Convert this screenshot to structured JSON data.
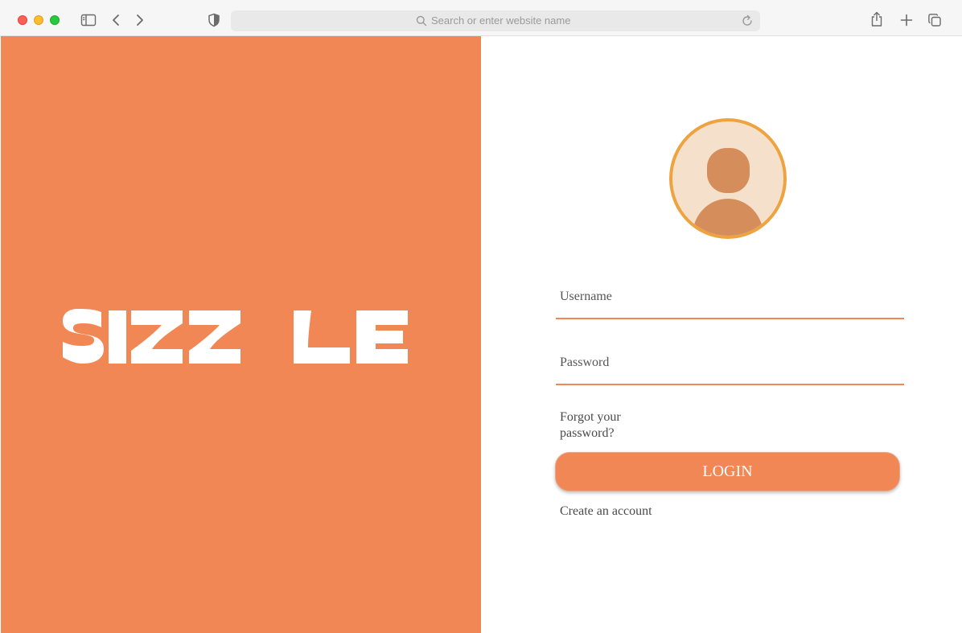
{
  "browser": {
    "address_placeholder": "Search or enter website name",
    "icons": [
      "sidebar-icon",
      "back-icon",
      "forward-icon",
      "shield-icon",
      "search-icon",
      "reload-icon",
      "share-icon",
      "new-tab-icon",
      "tabs-overview-icon"
    ]
  },
  "brand": {
    "logo_text": "SIZZLE",
    "background_color": "#f08755",
    "logo_color": "#ffffff"
  },
  "login": {
    "avatar_icon": "user-avatar-icon",
    "username_placeholder": "Username",
    "password_placeholder": "Password",
    "forgot_line1": "Forgot your",
    "forgot_line2": "password?",
    "login_label": "LOGIN",
    "create_account": "Create an account",
    "accent_color": "#f08755",
    "avatar_ring_color": "#eea340"
  }
}
